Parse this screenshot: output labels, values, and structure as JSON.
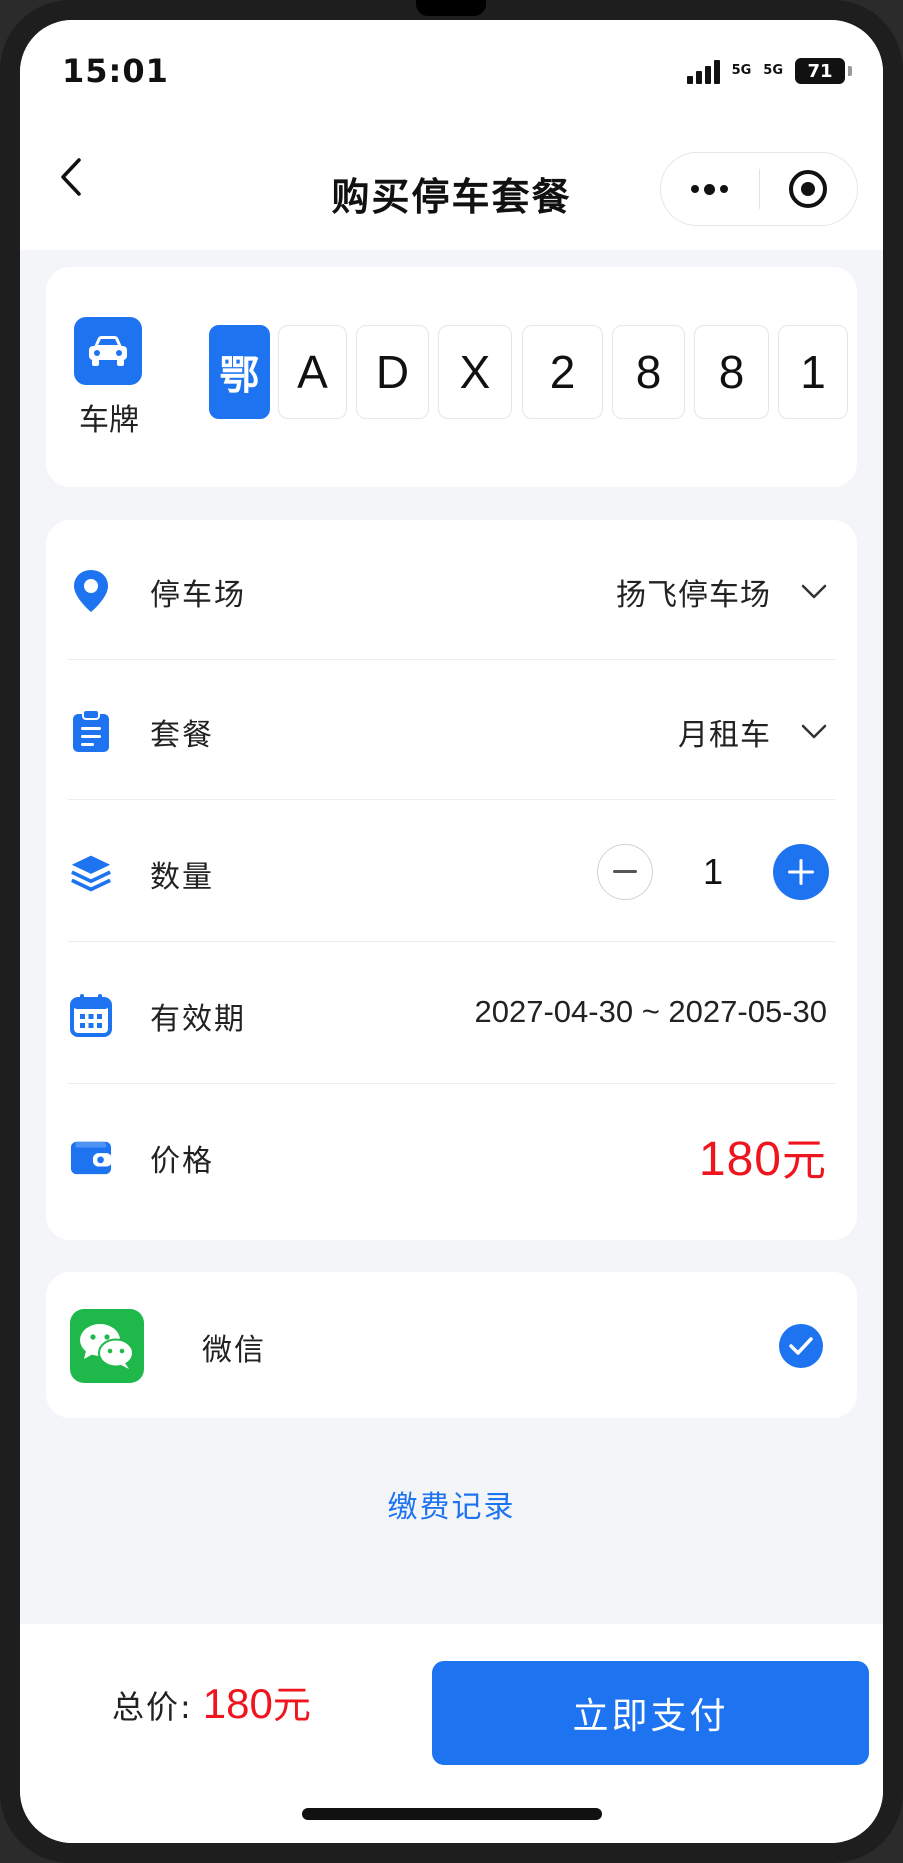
{
  "status_bar": {
    "time": "15:01",
    "network_1": "5G",
    "network_2": "5G",
    "battery": "71"
  },
  "nav": {
    "title": "购买停车套餐"
  },
  "plate": {
    "label": "车牌",
    "characters": [
      "鄂",
      "A",
      "D",
      "X",
      "2",
      "8",
      "8",
      "1"
    ]
  },
  "details": {
    "lot": {
      "label": "停车场",
      "value": "扬飞停车场"
    },
    "package": {
      "label": "套餐",
      "value": "月租车"
    },
    "quantity": {
      "label": "数量",
      "value": "1"
    },
    "validity": {
      "label": "有效期",
      "value": "2027-04-30 ~ 2027-05-30"
    },
    "price": {
      "label": "价格",
      "amount": "180",
      "unit": "元"
    }
  },
  "payment": {
    "method": "微信",
    "selected": true
  },
  "records_link": "缴费记录",
  "footer": {
    "total_label": "总价:",
    "total_amount": "180",
    "total_unit": "元",
    "pay_button": "立即支付"
  },
  "colors": {
    "accent": "#1e74f0",
    "price": "#f0141e",
    "wechat": "#1fb84a"
  }
}
